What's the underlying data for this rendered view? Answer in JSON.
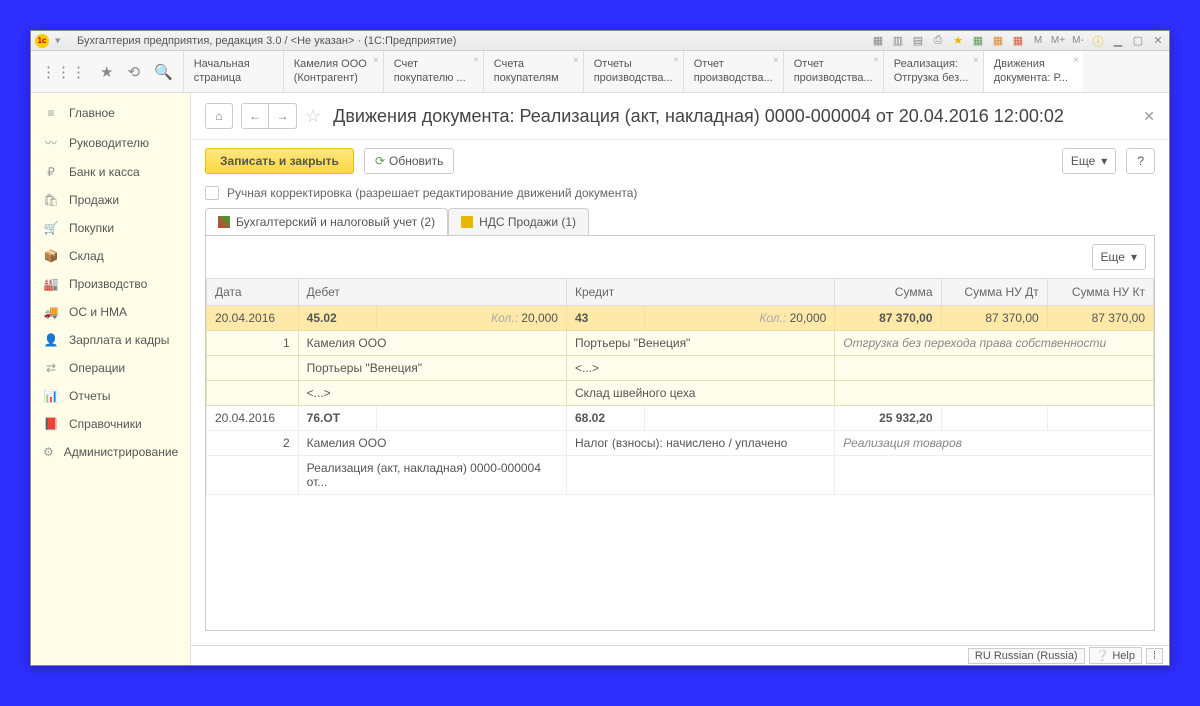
{
  "titlebar": {
    "text": "Бухгалтерия предприятия, редакция 3.0 / <Не указан> · (1С:Предприятие)"
  },
  "tabs": [
    {
      "l1": "Начальная",
      "l2": "страница"
    },
    {
      "l1": "Камелия ООО",
      "l2": "(Контрагент)"
    },
    {
      "l1": "Счет",
      "l2": "покупателю ..."
    },
    {
      "l1": "Счета",
      "l2": "покупателям"
    },
    {
      "l1": "Отчеты",
      "l2": "производства..."
    },
    {
      "l1": "Отчет",
      "l2": "производства..."
    },
    {
      "l1": "Отчет",
      "l2": "производства..."
    },
    {
      "l1": "Реализация:",
      "l2": "Отгрузка без..."
    },
    {
      "l1": "Движения",
      "l2": "документа: Р..."
    }
  ],
  "sidebar": [
    {
      "icon": "≡",
      "label": "Главное"
    },
    {
      "icon": "〰",
      "label": "Руководителю"
    },
    {
      "icon": "₽",
      "label": "Банк и касса"
    },
    {
      "icon": "🛍",
      "label": "Продажи"
    },
    {
      "icon": "🛒",
      "label": "Покупки"
    },
    {
      "icon": "📦",
      "label": "Склад"
    },
    {
      "icon": "🏭",
      "label": "Производство"
    },
    {
      "icon": "🚚",
      "label": "ОС и НМА"
    },
    {
      "icon": "👤",
      "label": "Зарплата и кадры"
    },
    {
      "icon": "⇄",
      "label": "Операции"
    },
    {
      "icon": "📊",
      "label": "Отчеты"
    },
    {
      "icon": "📕",
      "label": "Справочники"
    },
    {
      "icon": "⚙",
      "label": "Администрирование"
    }
  ],
  "page": {
    "title": "Движения документа: Реализация (акт, накладная) 0000-000004 от 20.04.2016 12:00:02",
    "save_btn": "Записать и закрыть",
    "refresh_btn": "Обновить",
    "more_btn": "Еще",
    "help_btn": "?",
    "checkbox_label": "Ручная корректировка (разрешает редактирование движений документа)"
  },
  "inner_tabs": [
    {
      "label": "Бухгалтерский и налоговый учет (2)"
    },
    {
      "label": "НДС Продажи (1)"
    }
  ],
  "grid": {
    "more_btn": "Еще",
    "headers": {
      "date": "Дата",
      "debit": "Дебет",
      "credit": "Кредит",
      "sum": "Сумма",
      "sum_nu_dt": "Сумма НУ Дт",
      "sum_nu_kt": "Сумма НУ Кт"
    },
    "qty_label": "Кол.:",
    "rows": [
      {
        "date": "20.04.2016",
        "n": "1",
        "dt_acc": "45.02",
        "dt_qty": "20,000",
        "kt_acc": "43",
        "kt_qty": "20,000",
        "sum": "87 370,00",
        "nu_dt": "87 370,00",
        "nu_kt": "87 370,00",
        "dt_sub1": "Камелия ООО",
        "dt_sub2": "Портьеры \"Венеция\"",
        "dt_sub3": "<...>",
        "kt_sub1": "Портьеры \"Венеция\"",
        "kt_sub2": "<...>",
        "kt_sub3": "Склад швейного цеха",
        "note": "Отгрузка без перехода права собственности"
      },
      {
        "date": "20.04.2016",
        "n": "2",
        "dt_acc": "76.ОТ",
        "kt_acc": "68.02",
        "sum": "25 932,20",
        "dt_sub1": "Камелия ООО",
        "dt_sub2": "Реализация (акт, накладная) 0000-000004 от...",
        "kt_sub1": "Налог (взносы): начислено / уплачено",
        "note": "Реализация товаров"
      }
    ]
  },
  "statusbar": {
    "lang": "RU Russian (Russia)",
    "help": "Help"
  }
}
